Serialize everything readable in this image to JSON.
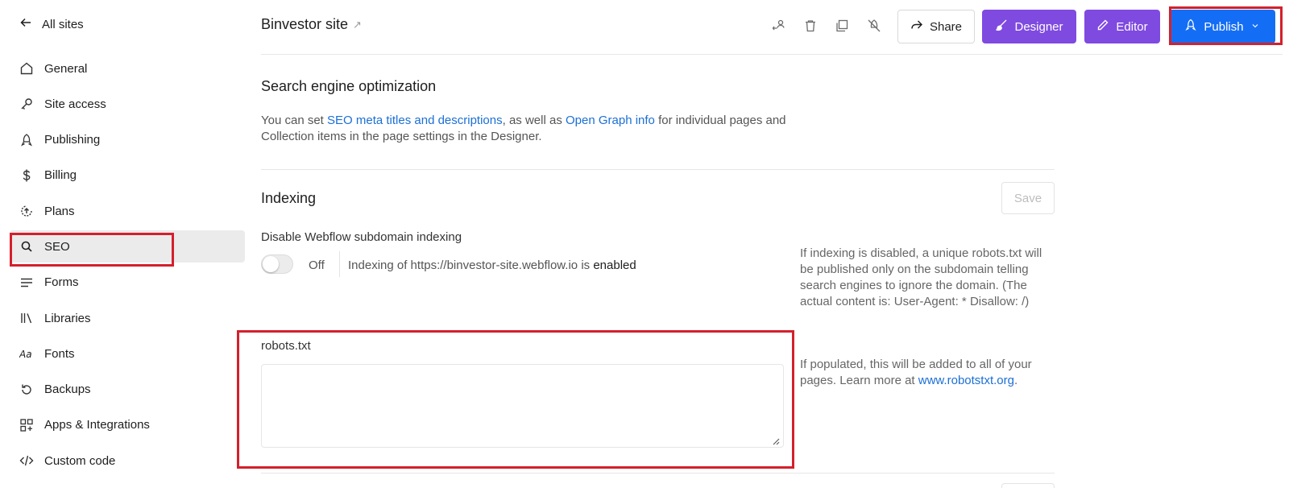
{
  "sidebar": {
    "back_label": "All sites",
    "items": [
      {
        "label": "General",
        "icon": "home-icon"
      },
      {
        "label": "Site access",
        "icon": "key-icon"
      },
      {
        "label": "Publishing",
        "icon": "rocket-icon"
      },
      {
        "label": "Billing",
        "icon": "dollar-icon"
      },
      {
        "label": "Plans",
        "icon": "plans-icon"
      },
      {
        "label": "SEO",
        "icon": "search-icon",
        "active": true
      },
      {
        "label": "Forms",
        "icon": "forms-icon"
      },
      {
        "label": "Libraries",
        "icon": "libraries-icon"
      },
      {
        "label": "Fonts",
        "icon": "fonts-icon"
      },
      {
        "label": "Backups",
        "icon": "backup-icon"
      },
      {
        "label": "Apps & Integrations",
        "icon": "apps-icon"
      },
      {
        "label": "Custom code",
        "icon": "code-icon"
      }
    ]
  },
  "header": {
    "site_title": "Binvestor site",
    "share_label": "Share",
    "designer_label": "Designer",
    "editor_label": "Editor",
    "publish_label": "Publish"
  },
  "seo": {
    "title": "Search engine optimization",
    "desc_1": "You can set ",
    "desc_link_1": "SEO meta titles and descriptions",
    "desc_2": ", as well as ",
    "desc_link_2": "Open Graph info",
    "desc_3": " for individual pages and Collection items in the page settings in the Designer."
  },
  "indexing": {
    "title": "Indexing",
    "save_label": "Save",
    "disable_label": "Disable Webflow subdomain indexing",
    "toggle_state": "Off",
    "status_prefix": "Indexing of https://binvestor-site.webflow.io is ",
    "status_value": "enabled",
    "help_text": "If indexing is disabled, a unique robots.txt will be published only on the subdomain telling search engines to ignore the domain. (The actual content is: User-Agent: * Disallow: /)"
  },
  "robots": {
    "label": "robots.txt",
    "value": "",
    "help_prefix": "If populated, this will be added to all of your pages. Learn more at ",
    "help_link": "www.robotstxt.org",
    "help_suffix": "."
  },
  "colors": {
    "accent_purple": "#7f4ae0",
    "publish_blue": "#146ef5",
    "highlight_red": "#d4202c",
    "link_blue": "#1b6fd6"
  }
}
